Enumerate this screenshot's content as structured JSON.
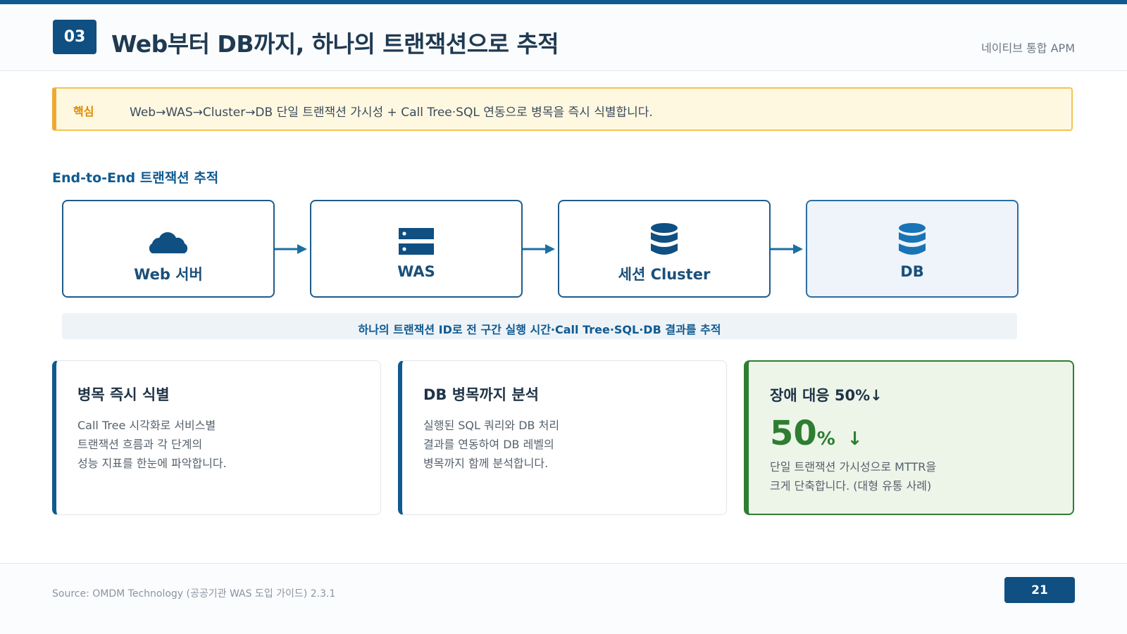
{
  "header": {
    "slide_number": "03",
    "title": "Web부터 DB까지, 하나의 트랜잭션으로 추적",
    "right_label": "네이티브 통합 APM"
  },
  "key_message": {
    "label": "핵심",
    "text": "Web→WAS→Cluster→DB 단일 트랜잭션 가시성 + Call Tree·SQL 연동으로 병목을 즉시 식별합니다."
  },
  "flow": {
    "title": "End-to-End 트랜잭션 추적",
    "nodes": [
      {
        "label": "Web 서버",
        "icon": "cloud-icon"
      },
      {
        "label": "WAS",
        "icon": "server-icon"
      },
      {
        "label": "세션 Cluster",
        "icon": "database-icon"
      },
      {
        "label": "DB",
        "icon": "database-icon"
      }
    ],
    "caption": "하나의 트랜잭션 ID로 전 구간 실행 시간·Call Tree·SQL·DB 결과를 추적"
  },
  "cards": [
    {
      "title": "병목 즉시 식별",
      "lines": [
        "Call Tree 시각화로 서비스별",
        "트랜잭션 흐름과 각 단계의",
        "성능 지표를 한눈에 파악합니다."
      ]
    },
    {
      "title": "DB 병목까지 분석",
      "lines": [
        "실행된 SQL 쿼리와 DB 처리",
        "결과를 연동하여 DB 레벨의",
        "병목까지 함께 분석합니다."
      ]
    },
    {
      "title": "장애 대응 50%↓",
      "stat_value": "50",
      "stat_unit": "%",
      "stat_arrow": "↓",
      "lines": [
        "단일 트랜잭션 가시성으로 MTTR을",
        "크게 단축합니다. (대형 유통 사례)"
      ]
    }
  ],
  "footer": {
    "source": "Source: OMDM Technology (공공기관 WAS 도입 가이드) 2.3.1",
    "page_number": "21"
  },
  "colors": {
    "primary": "#0f5a91",
    "accent_amber": "#f0a830",
    "success_green": "#2e7d32"
  }
}
